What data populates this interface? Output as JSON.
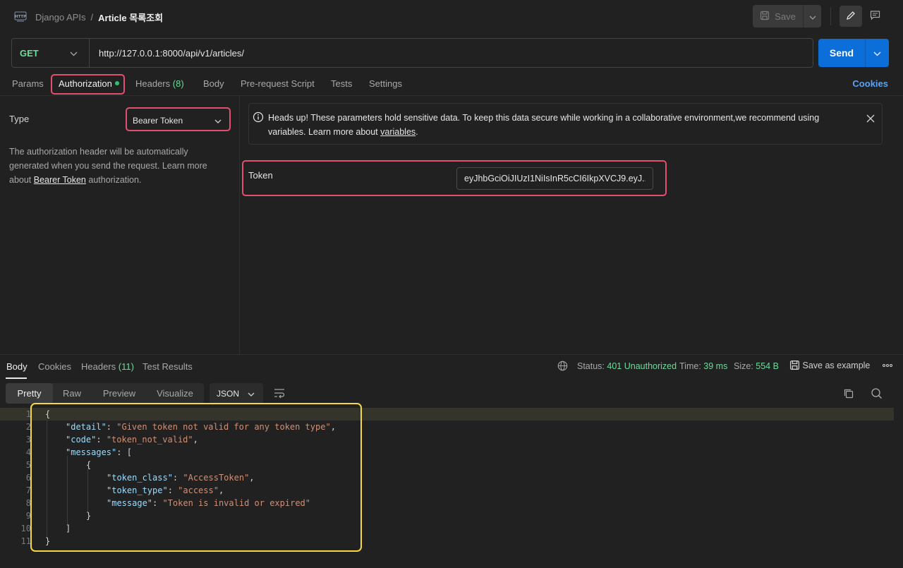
{
  "header": {
    "breadcrumb_parent": "Django APIs",
    "breadcrumb_sep": "/",
    "breadcrumb_current": "Article 목록조회",
    "save_label": "Save"
  },
  "request": {
    "method": "GET",
    "url": "http://127.0.0.1:8000/api/v1/articles/",
    "send_label": "Send"
  },
  "tabs": {
    "params": "Params",
    "authorization": "Authorization",
    "headers": "Headers",
    "headers_count": "(8)",
    "body": "Body",
    "prerequest": "Pre-request Script",
    "tests": "Tests",
    "settings": "Settings",
    "cookies": "Cookies"
  },
  "auth": {
    "type_label": "Type",
    "type_value": "Bearer Token",
    "desc_1": "The authorization header will be automatically generated when you send the request. Learn more about ",
    "desc_link": "Bearer Token",
    "desc_2": " authorization.",
    "notice_1": "Heads up! These parameters hold sensitive data. To keep this data secure while working in a collaborative environment,we recommend using variables. Learn more about ",
    "notice_link": "variables",
    "notice_2": ".",
    "token_label": "Token",
    "token_value": "eyJhbGciOiJIUzI1NiIsInR5cCI6IkpXVCJ9.eyJ..."
  },
  "response": {
    "tabs": {
      "body": "Body",
      "cookies": "Cookies",
      "headers": "Headers",
      "headers_count": "(11)",
      "test_results": "Test Results"
    },
    "status_label": "Status:",
    "status_value": "401 Unauthorized",
    "time_label": "Time:",
    "time_value": "39 ms",
    "size_label": "Size:",
    "size_value": "554 B",
    "save_example": "Save as example",
    "views": {
      "pretty": "Pretty",
      "raw": "Raw",
      "preview": "Preview",
      "visualize": "Visualize"
    },
    "format": "JSON",
    "line_numbers": [
      "1",
      "2",
      "3",
      "4",
      "5",
      "6",
      "7",
      "8",
      "9",
      "10",
      "11"
    ],
    "lines": [
      {
        "k": "",
        "s": "",
        "p": "{"
      },
      {
        "k": "\"detail\"",
        "p": ": ",
        "s": "\"Given token not valid for any token type\"",
        "e": ","
      },
      {
        "k": "\"code\"",
        "p": ": ",
        "s": "\"token_not_valid\"",
        "e": ","
      },
      {
        "k": "\"messages\"",
        "p": ": [",
        "s": "",
        "e": ""
      },
      {
        "k": "",
        "s": "",
        "p": "{"
      },
      {
        "k": "\"token_class\"",
        "p": ": ",
        "s": "\"AccessToken\"",
        "e": ","
      },
      {
        "k": "\"token_type\"",
        "p": ": ",
        "s": "\"access\"",
        "e": ","
      },
      {
        "k": "\"message\"",
        "p": ": ",
        "s": "\"Token is invalid or expired\"",
        "e": ""
      },
      {
        "k": "",
        "s": "",
        "p": "}"
      },
      {
        "k": "",
        "s": "",
        "p": "]"
      },
      {
        "k": "",
        "s": "",
        "p": "}"
      }
    ]
  }
}
